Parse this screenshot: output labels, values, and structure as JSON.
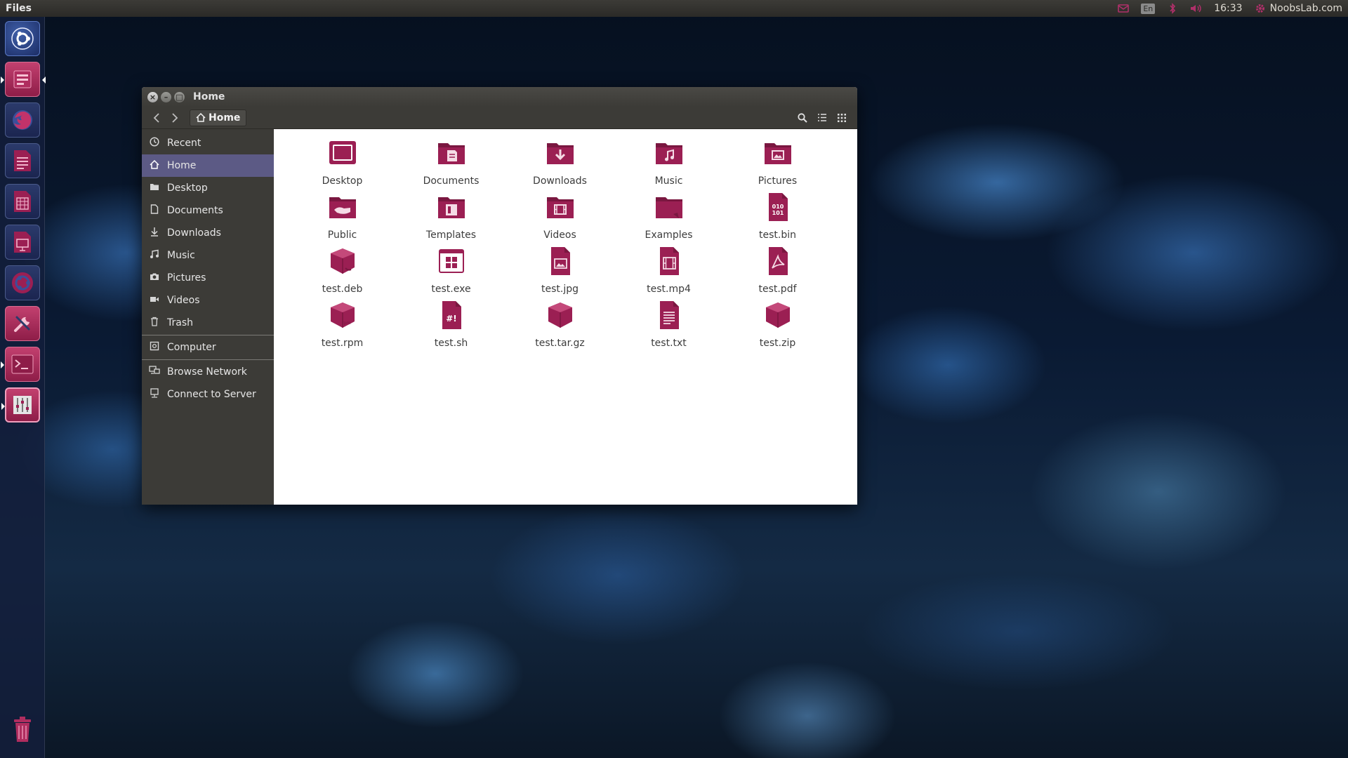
{
  "top_panel": {
    "app_name": "Files",
    "lang": "En",
    "time": "16:33",
    "user": "NoobsLab.com"
  },
  "launcher": {
    "items": [
      {
        "name": "dash-icon"
      },
      {
        "name": "files-icon"
      },
      {
        "name": "firefox-icon"
      },
      {
        "name": "writer-icon"
      },
      {
        "name": "calc-icon"
      },
      {
        "name": "impress-icon"
      },
      {
        "name": "software-center-icon"
      },
      {
        "name": "system-settings-icon"
      },
      {
        "name": "terminal-icon"
      },
      {
        "name": "tweak-tool-icon"
      },
      {
        "name": "trash-icon"
      }
    ]
  },
  "window": {
    "title": "Home",
    "path": "Home",
    "sidebar": [
      {
        "label": "Recent",
        "icon": "clock-icon"
      },
      {
        "label": "Home",
        "icon": "home-icon"
      },
      {
        "label": "Desktop",
        "icon": "folder-icon"
      },
      {
        "label": "Documents",
        "icon": "document-icon"
      },
      {
        "label": "Downloads",
        "icon": "download-icon"
      },
      {
        "label": "Music",
        "icon": "music-icon"
      },
      {
        "label": "Pictures",
        "icon": "camera-icon"
      },
      {
        "label": "Videos",
        "icon": "video-icon"
      },
      {
        "label": "Trash",
        "icon": "trash-icon"
      },
      {
        "label": "Computer",
        "icon": "computer-icon"
      },
      {
        "label": "Browse Network",
        "icon": "network-icon"
      },
      {
        "label": "Connect to Server",
        "icon": "server-icon"
      }
    ],
    "files": [
      {
        "label": "Desktop",
        "icon": "desktop-folder-icon"
      },
      {
        "label": "Documents",
        "icon": "documents-folder-icon"
      },
      {
        "label": "Downloads",
        "icon": "downloads-folder-icon"
      },
      {
        "label": "Music",
        "icon": "music-folder-icon"
      },
      {
        "label": "Pictures",
        "icon": "pictures-folder-icon"
      },
      {
        "label": "Public",
        "icon": "public-folder-icon"
      },
      {
        "label": "Templates",
        "icon": "templates-folder-icon"
      },
      {
        "label": "Videos",
        "icon": "videos-folder-icon"
      },
      {
        "label": "Examples",
        "icon": "examples-folder-icon"
      },
      {
        "label": "test.bin",
        "icon": "binary-file-icon",
        "glyph": "010\n101"
      },
      {
        "label": "test.deb",
        "icon": "deb-package-icon"
      },
      {
        "label": "test.exe",
        "icon": "exe-file-icon"
      },
      {
        "label": "test.jpg",
        "icon": "image-file-icon"
      },
      {
        "label": "test.mp4",
        "icon": "video-file-icon"
      },
      {
        "label": "test.pdf",
        "icon": "pdf-file-icon"
      },
      {
        "label": "test.rpm",
        "icon": "rpm-package-icon"
      },
      {
        "label": "test.sh",
        "icon": "script-file-icon",
        "glyph": "#!"
      },
      {
        "label": "test.tar.gz",
        "icon": "archive-icon"
      },
      {
        "label": "test.txt",
        "icon": "text-file-icon"
      },
      {
        "label": "test.zip",
        "icon": "zip-archive-icon"
      }
    ]
  },
  "colors": {
    "accent": "#9b1f53",
    "accent_dark": "#7a1740",
    "panel": "#3c3b37",
    "selection": "#5c5a85"
  }
}
